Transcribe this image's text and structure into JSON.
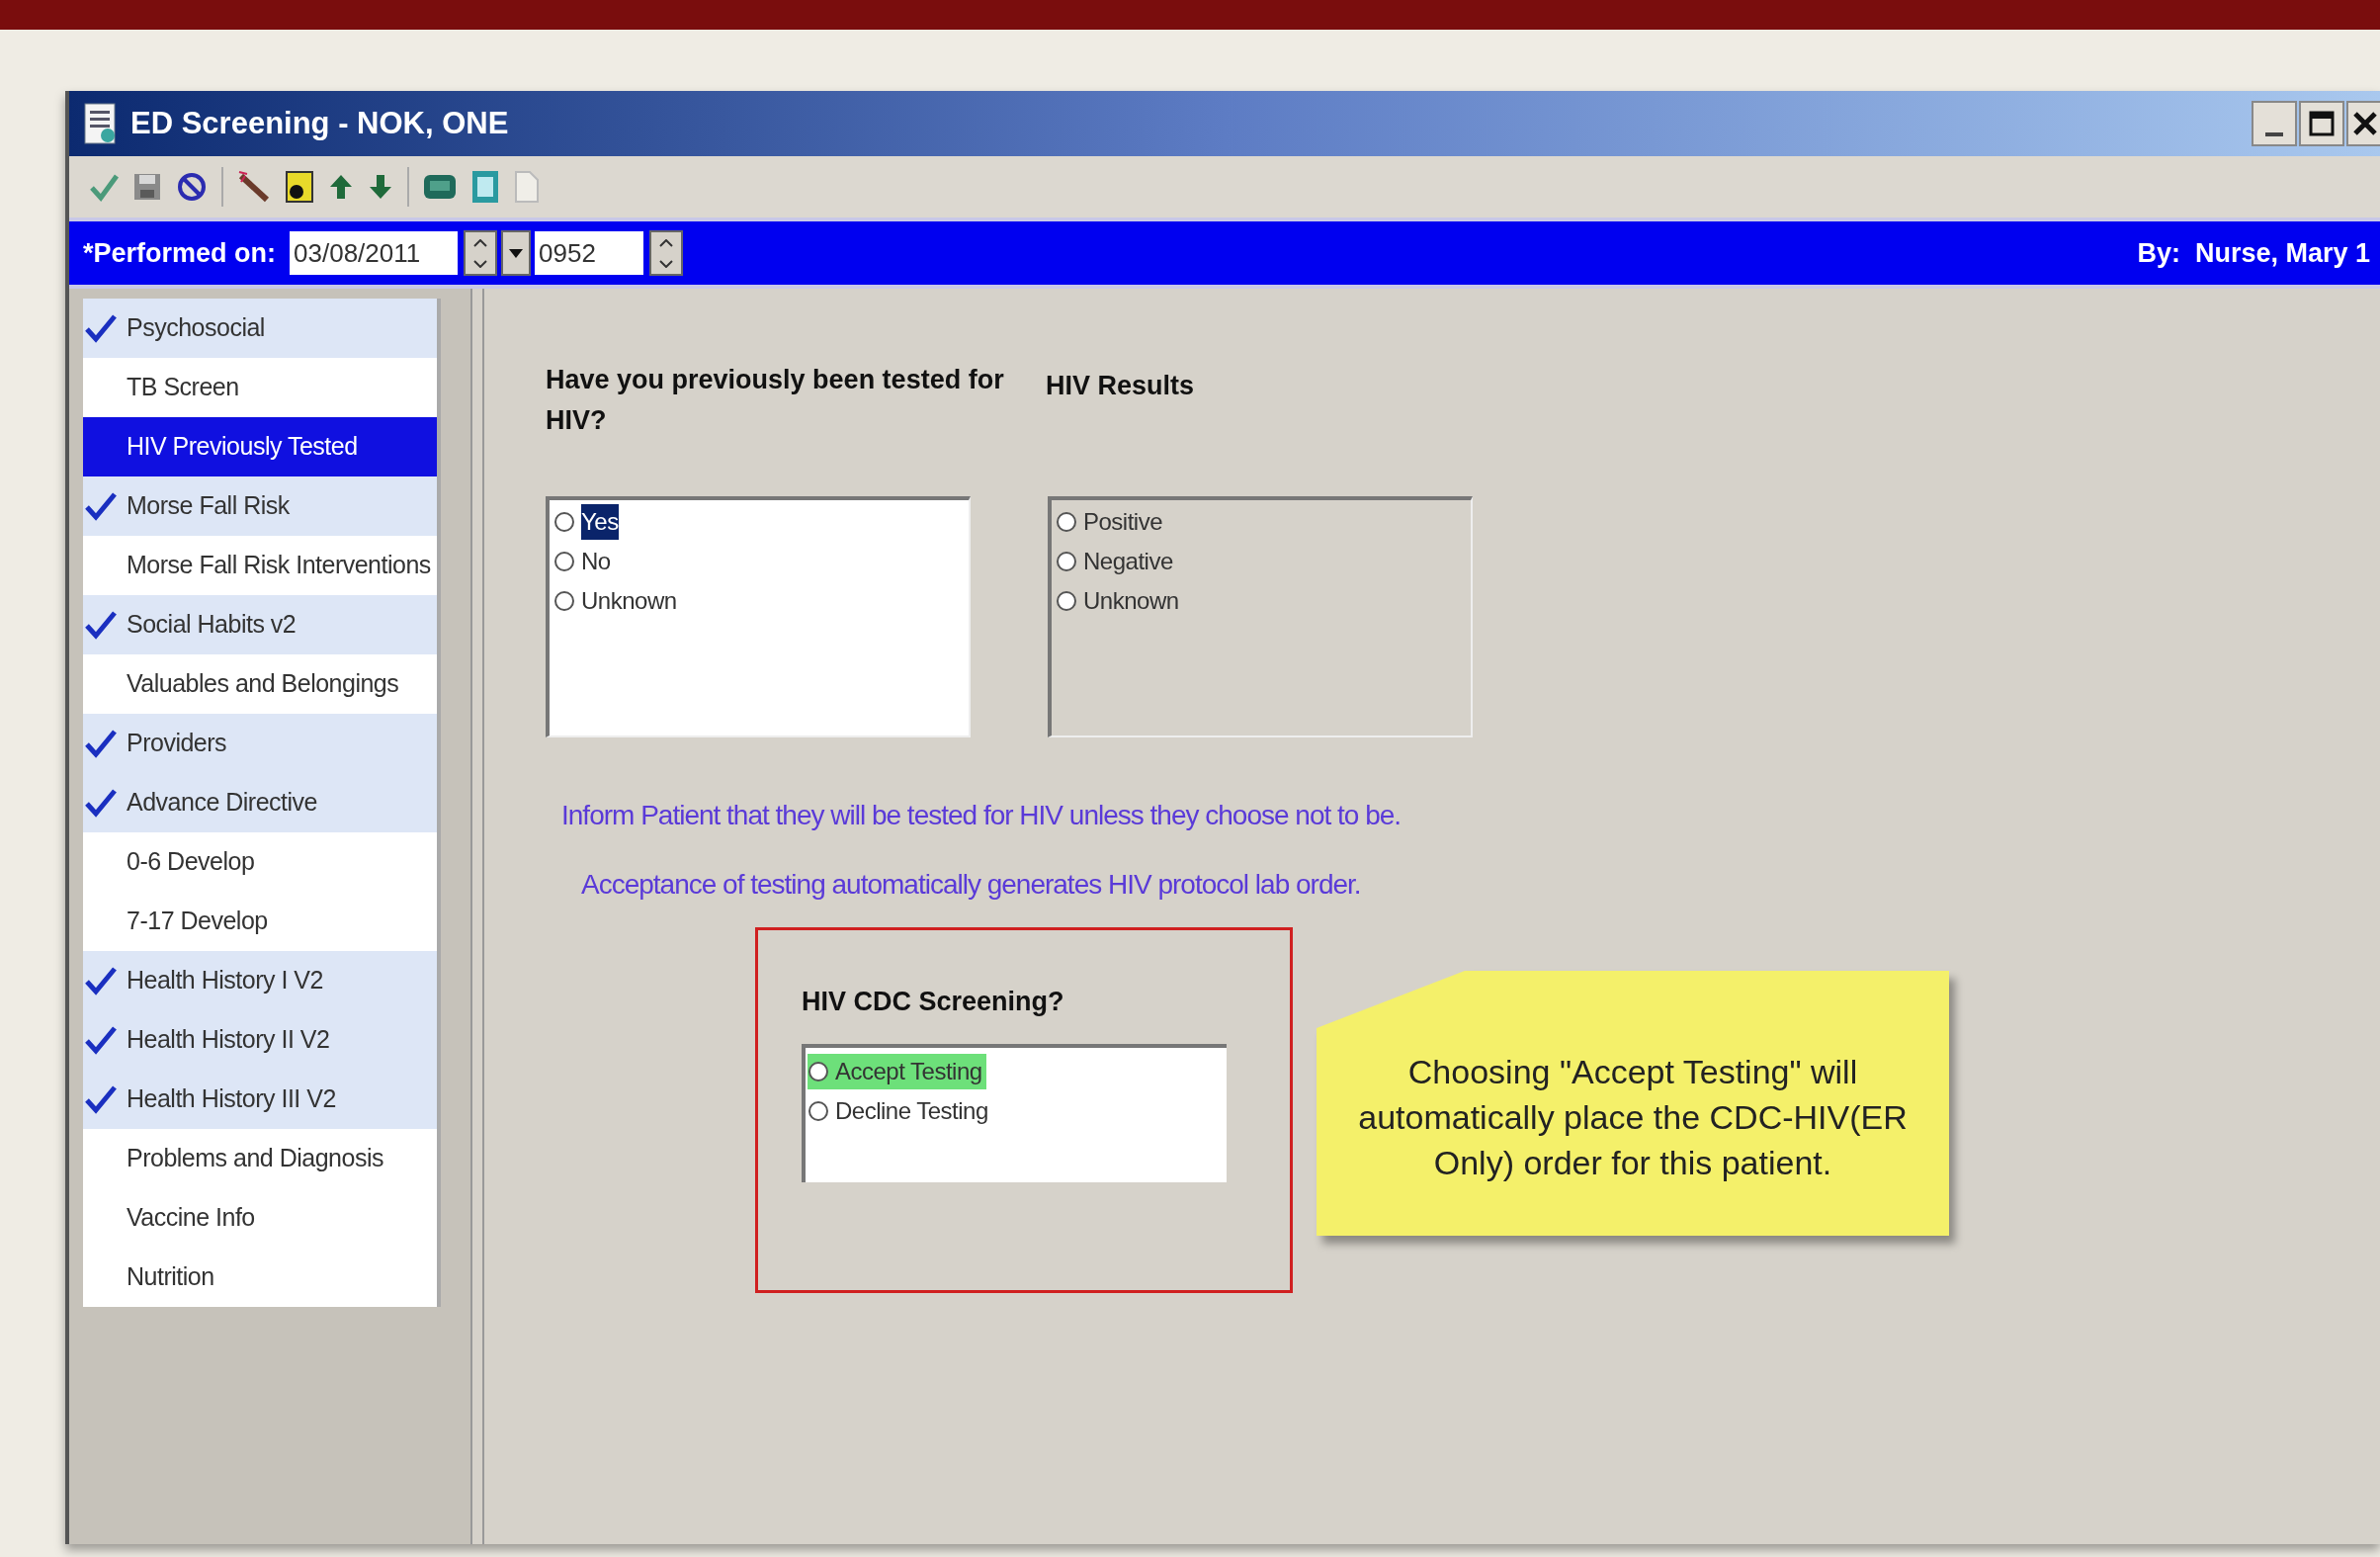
{
  "window": {
    "title": "ED Screening - NOK, ONE"
  },
  "header": {
    "performed_label": "*Performed on:",
    "date": "03/08/2011",
    "time": "0952",
    "by": "By:  Nurse, Mary 1"
  },
  "sidebar": {
    "items": [
      {
        "label": "Psychosocial",
        "checked": true,
        "selected": false
      },
      {
        "label": "TB Screen",
        "checked": false,
        "selected": false
      },
      {
        "label": "HIV Previously Tested",
        "checked": false,
        "selected": true
      },
      {
        "label": "Morse Fall Risk",
        "checked": true,
        "selected": false
      },
      {
        "label": "Morse Fall Risk Interventions",
        "checked": false,
        "selected": false
      },
      {
        "label": "Social Habits v2",
        "checked": true,
        "selected": false
      },
      {
        "label": "Valuables and Belongings",
        "checked": false,
        "selected": false
      },
      {
        "label": "Providers",
        "checked": true,
        "selected": false
      },
      {
        "label": "Advance Directive",
        "checked": true,
        "selected": false
      },
      {
        "label": "0-6 Develop",
        "checked": false,
        "selected": false
      },
      {
        "label": "7-17 Develop",
        "checked": false,
        "selected": false
      },
      {
        "label": "Health History I V2",
        "checked": true,
        "selected": false
      },
      {
        "label": "Health History II V2",
        "checked": true,
        "selected": false
      },
      {
        "label": "Health History III V2",
        "checked": true,
        "selected": false
      },
      {
        "label": "Problems and Diagnosis",
        "checked": false,
        "selected": false
      },
      {
        "label": "Vaccine Info",
        "checked": false,
        "selected": false
      },
      {
        "label": "Nutrition",
        "checked": false,
        "selected": false
      }
    ]
  },
  "questions": [
    {
      "label": "Have you previously been tested for HIV?",
      "enabled": true,
      "options": [
        {
          "label": "Yes",
          "selected": false,
          "highlighted": true
        },
        {
          "label": "No",
          "selected": false,
          "highlighted": false
        },
        {
          "label": "Unknown",
          "selected": false,
          "highlighted": false
        }
      ]
    },
    {
      "label": "HIV Results",
      "enabled": false,
      "options": [
        {
          "label": "Positive",
          "selected": false,
          "highlighted": false
        },
        {
          "label": "Negative",
          "selected": false,
          "highlighted": false
        },
        {
          "label": "Unknown",
          "selected": false,
          "highlighted": false
        }
      ]
    }
  ],
  "info_lines": [
    "Inform Patient that they will be tested for HIV unless they choose not to be.",
    "Acceptance of testing automatically generates HIV protocol lab order."
  ],
  "screening": {
    "label": "HIV CDC Screening?",
    "options": [
      {
        "label": "Accept Testing",
        "selected": false,
        "highlighted": true
      },
      {
        "label": "Decline Testing",
        "selected": false,
        "highlighted": false
      }
    ]
  },
  "note": {
    "text": "Choosing \"Accept Testing\" will automatically place the CDC-HIV(ER Only) order for this patient."
  }
}
